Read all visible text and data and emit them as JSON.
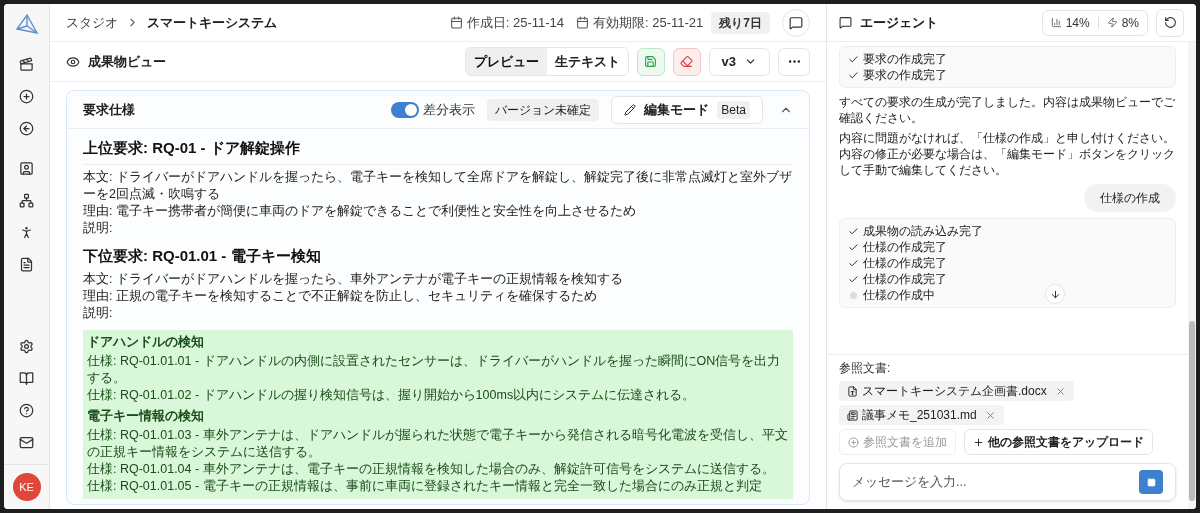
{
  "sidebar": {
    "avatar": "KE"
  },
  "header": {
    "breadcrumb": [
      "スタジオ",
      "スマートキーシステム"
    ],
    "created": "作成日: 25-11-14",
    "expires": "有効期限: 25-11-21",
    "remaining": "残り7日"
  },
  "toolbar": {
    "title": "成果物ビュー",
    "view_tabs": [
      {
        "label": "プレビュー",
        "selected": true
      },
      {
        "label": "生テキスト",
        "selected": false
      }
    ],
    "version": "v3"
  },
  "card": {
    "title": "要求仕様",
    "diff_toggle": {
      "label": "差分表示",
      "on": true
    },
    "status_badge": "バージョン未確定",
    "edit_button": {
      "label": "編集モード",
      "badge": "Beta"
    },
    "expanded": true,
    "blocks": [
      {
        "kind": "title",
        "text": "上位要求: RQ-01 - ドア解錠操作"
      },
      {
        "kind": "paragraph",
        "lines": [
          "本文: ドライバーがドアハンドルを握ったら、電子キーを検知して全席ドアを解錠し、解錠完了後に非常点滅灯と室外ブザーを2回点滅・吹鳴する",
          "理由: 電子キー携帯者が簡便に車両のドアを解錠できることで利便性と安全性を向上させるため",
          "説明:"
        ]
      },
      {
        "kind": "subtitle",
        "text": "下位要求: RQ-01.01 - 電子キー検知"
      },
      {
        "kind": "paragraph",
        "lines": [
          "本文: ドライバーがドアハンドルを握ったら、車外アンテナが電子キーの正規情報を検知する",
          "理由: 正規の電子キーを検知することで不正解錠を防止し、セキュリティを確保するため",
          "説明:"
        ]
      },
      {
        "kind": "added",
        "groups": [
          {
            "heading": "ドアハンドルの検知",
            "lines": [
              "仕様: RQ-01.01.01 - ドアハンドルの内側に設置されたセンサーは、ドライバーがハンドルを握った瞬間にON信号を出力する。",
              "仕様: RQ-01.01.02 - ドアハンドルの握り検知信号は、握り開始から100ms以内にシステムに伝達される。"
            ]
          },
          {
            "heading": "電子キー情報の検知",
            "lines": [
              "仕様: RQ-01.01.03 - 車外アンテナは、ドアハンドルが握られた状態で電子キーから発信される暗号化電波を受信し、平文の正規キー情報をシステムに送信する。",
              "仕様: RQ-01.01.04 - 車外アンテナは、電子キーの正規情報を検知した場合のみ、解錠許可信号をシステムに送信する。",
              "仕様: RQ-01.01.05 - 電子キーの正規情報は、事前に車両に登録されたキー情報と完全一致した場合にのみ正規と判定"
            ]
          }
        ]
      }
    ]
  },
  "agent": {
    "title": "エージェント",
    "stats": [
      {
        "kind": "usage",
        "value": "14%"
      },
      {
        "kind": "speed",
        "value": "8%"
      }
    ],
    "messages": [
      {
        "kind": "checklist",
        "items": [
          {
            "text": "要求の作成完了",
            "done": true
          },
          {
            "text": "要求の作成完了",
            "done": true
          }
        ]
      },
      {
        "kind": "assistant",
        "paragraphs": [
          "すべての要求の生成が完了しました。内容は成果物ビューでご確認ください。",
          "内容に問題がなければ、「仕様の作成」と申し付けください。内容の修正が必要な場合は、「編集モード」ボタンをクリックして手動で編集してください。"
        ]
      },
      {
        "kind": "user",
        "text": "仕様の作成"
      },
      {
        "kind": "checklist",
        "items": [
          {
            "text": "成果物の読み込み完了",
            "done": true
          },
          {
            "text": "仕様の作成完了",
            "done": true
          },
          {
            "text": "仕様の作成完了",
            "done": true
          },
          {
            "text": "仕様の作成完了",
            "done": true
          },
          {
            "text": "仕様の作成中",
            "done": false
          }
        ]
      }
    ],
    "references": {
      "label": "参照文書:",
      "files": [
        {
          "kind": "doc",
          "name": "スマートキーシステム企画書.docx"
        },
        {
          "kind": "memo",
          "name": "議事メモ_251031.md"
        }
      ],
      "add_button": {
        "label": "参照文書を追加",
        "disabled": true
      },
      "upload_button": "他の参照文書をアップロード"
    },
    "input": {
      "placeholder": "メッセージを入力..."
    }
  }
}
